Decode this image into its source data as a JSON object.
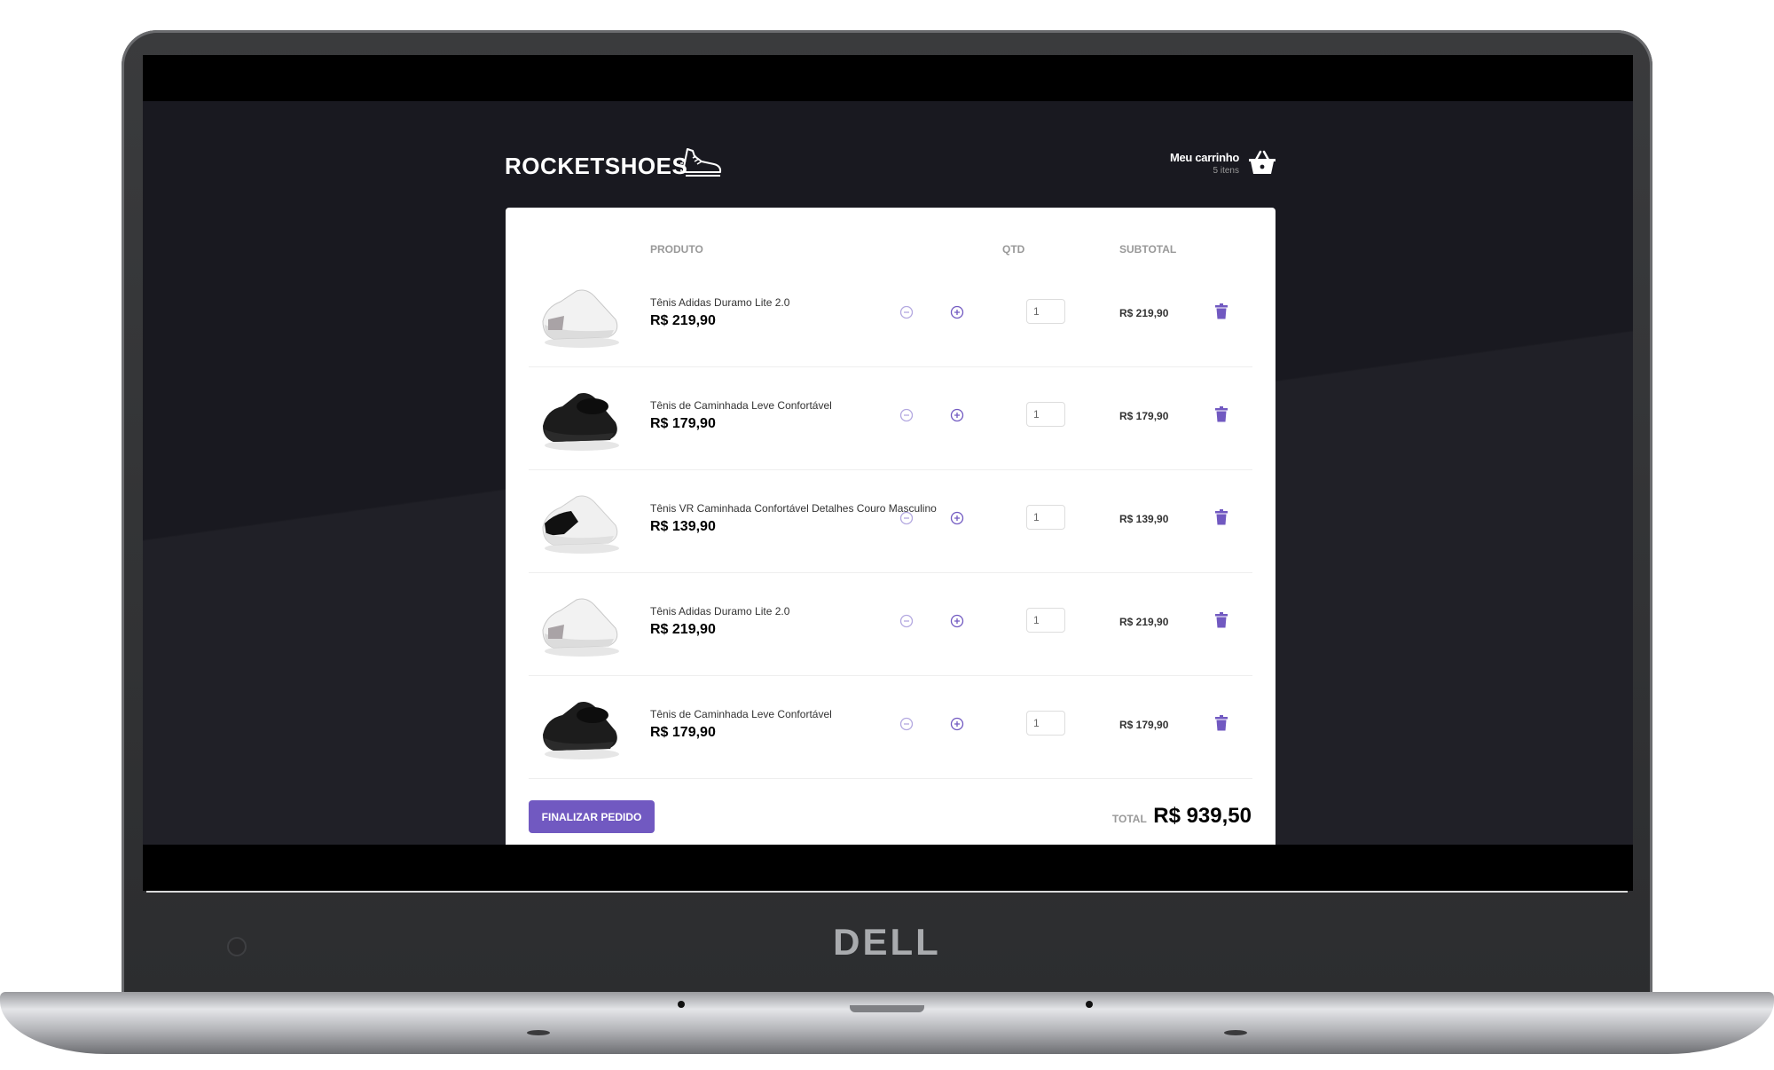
{
  "device": {
    "brand": "DELL"
  },
  "header": {
    "logo_text": "ROCKETSHOES",
    "cart_title": "Meu carrinho",
    "cart_count": "5 itens"
  },
  "table": {
    "col_product": "PRODUTO",
    "col_qty": "QTD",
    "col_subtotal": "SUBTOTAL"
  },
  "items": [
    {
      "name": "Tênis Adidas Duramo Lite 2.0",
      "price": "R$ 219,90",
      "qty": "1",
      "subtotal": "R$ 219,90",
      "shoe_color": "white"
    },
    {
      "name": "Tênis de Caminhada Leve Confortável",
      "price": "R$ 179,90",
      "qty": "1",
      "subtotal": "R$ 179,90",
      "shoe_color": "black"
    },
    {
      "name": "Tênis VR Caminhada Confortável Detalhes Couro Masculino",
      "price": "R$ 139,90",
      "qty": "1",
      "subtotal": "R$ 139,90",
      "shoe_color": "black-white"
    },
    {
      "name": "Tênis Adidas Duramo Lite 2.0",
      "price": "R$ 219,90",
      "qty": "1",
      "subtotal": "R$ 219,90",
      "shoe_color": "white"
    },
    {
      "name": "Tênis de Caminhada Leve Confortável",
      "price": "R$ 179,90",
      "qty": "1",
      "subtotal": "R$ 179,90",
      "shoe_color": "black"
    }
  ],
  "footer": {
    "checkout_label": "FINALIZAR PEDIDO",
    "total_label": "TOTAL",
    "total_value": "R$ 939,50"
  },
  "colors": {
    "accent": "#7159c1",
    "background": "#191920"
  }
}
